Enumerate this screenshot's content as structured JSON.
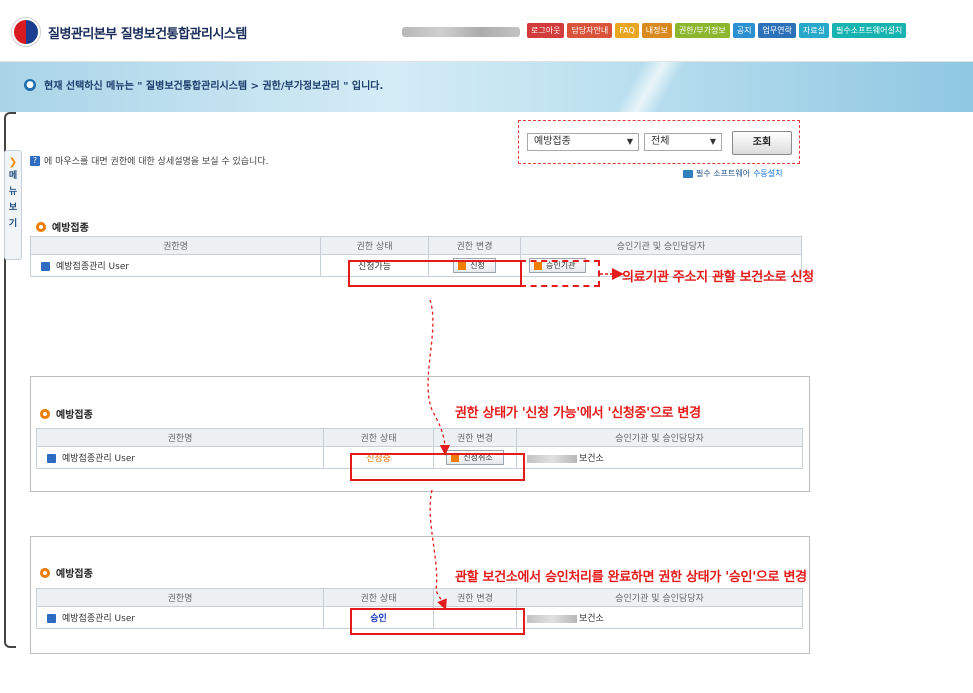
{
  "header": {
    "logo_text": "질병관리본부 질병보건통합관리시스템",
    "nav": [
      {
        "label": "로그아웃",
        "color": "#d23b3b"
      },
      {
        "label": "담당자안내",
        "color": "#d9533b"
      },
      {
        "label": "FAQ",
        "color": "#e8a623"
      },
      {
        "label": "내정보",
        "color": "#d98a1e"
      },
      {
        "label": "권한/부가정보",
        "color": "#8bb62e"
      },
      {
        "label": "공지",
        "color": "#2c8fcf"
      },
      {
        "label": "업무연락",
        "color": "#2d72b8"
      },
      {
        "label": "자료실",
        "color": "#27a7c9"
      },
      {
        "label": "필수소프트웨어설치",
        "color": "#17b3b0"
      }
    ]
  },
  "breadcrumb": "현재 선택하신 메뉴는 \" 질병보건통합관리시스템 > 권한/부가정보관리 \" 입니다.",
  "side_menu": {
    "chars": [
      "메",
      "뉴",
      "보",
      "기"
    ]
  },
  "filter": {
    "select1": "예방접종",
    "select2": "전체",
    "search_label": "조회",
    "software_prefix": "필수 소프트웨어 ",
    "software_link": "수동설치"
  },
  "info_text": "에 마우스를 대면 권한에 대한 상세설명을 보실 수 있습니다.",
  "table_headers": [
    "권한명",
    "권한 상태",
    "권한 변경",
    "승인기관 및 승인담당자"
  ],
  "sections": [
    {
      "title": "예방접종",
      "row": {
        "name": "예방접종관리 User",
        "status": "신청가능",
        "action": "신청",
        "approver_button": "승인기관"
      }
    },
    {
      "title": "예방접종",
      "row": {
        "name": "예방접종관리 User",
        "status": "신청중",
        "action": "신청취소",
        "approver": "보건소"
      }
    },
    {
      "title": "예방접종",
      "row": {
        "name": "예방접종관리 User",
        "status": "승인",
        "action": "",
        "approver": "보건소"
      }
    }
  ],
  "annotations": {
    "a1": "의료기관 주소지 관할 보건소로 신청",
    "a2": "권한 상태가 '신청 가능'에서 '신청중'으로 변경",
    "a3": "관할 보건소에서 승인처리를 완료하면 권한 상태가 '승인'으로 변경"
  },
  "colors": {
    "annotation": "#e41b1b",
    "status_pending": "#e07000",
    "status_approved": "#1a3cc0"
  }
}
